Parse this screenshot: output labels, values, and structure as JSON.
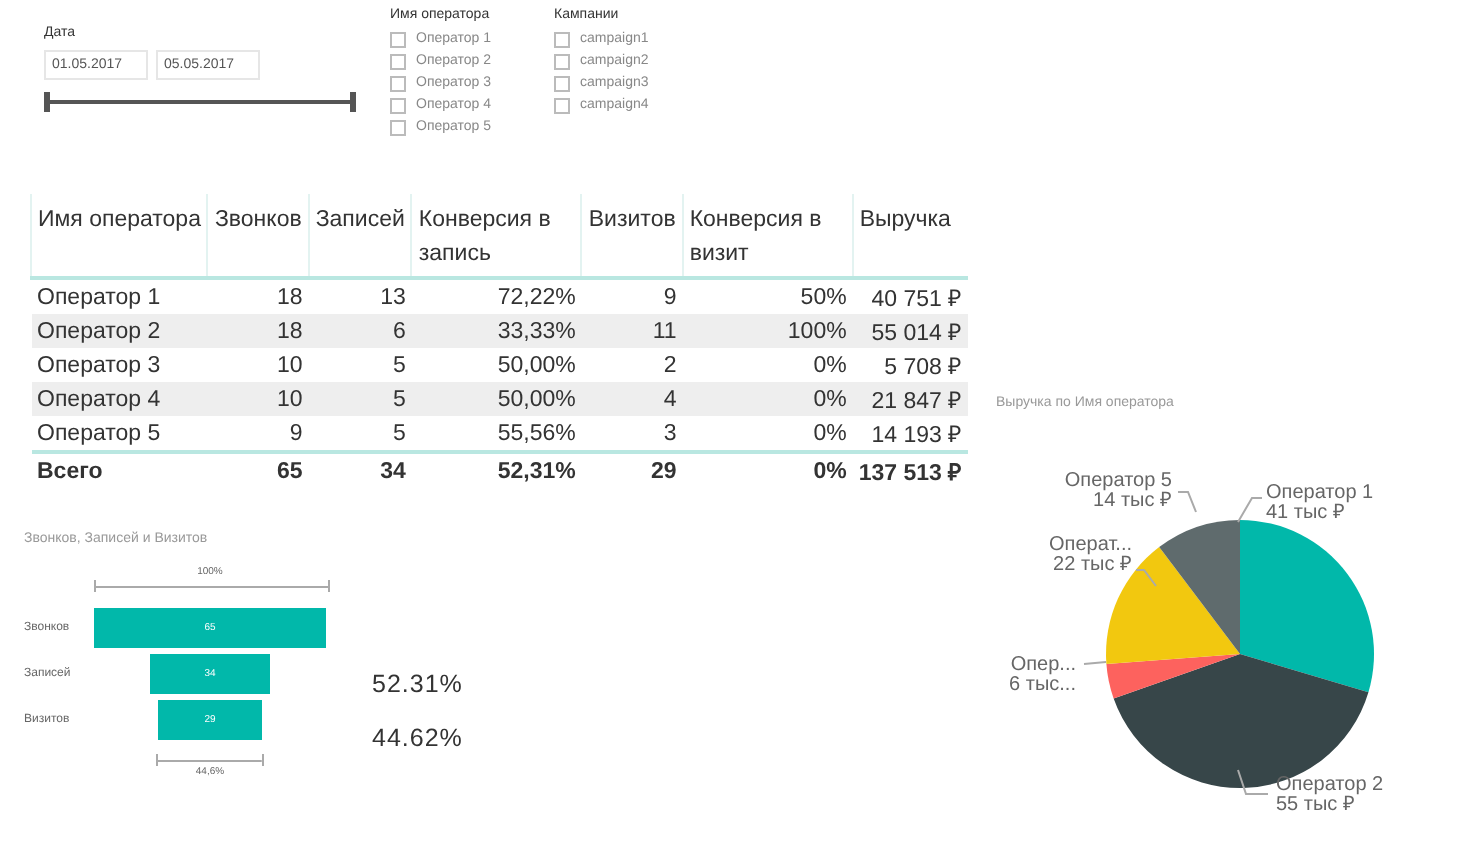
{
  "date_slicer": {
    "title": "Дата",
    "start": "01.05.2017",
    "end": "05.05.2017"
  },
  "operator_slicer": {
    "title": "Имя оператора",
    "items": [
      {
        "label": "Оператор 1",
        "checked": false
      },
      {
        "label": "Оператор 2",
        "checked": false
      },
      {
        "label": "Оператор 3",
        "checked": false
      },
      {
        "label": "Оператор 4",
        "checked": false
      },
      {
        "label": "Оператор 5",
        "checked": false
      }
    ]
  },
  "campaign_slicer": {
    "title": "Кампании",
    "items": [
      {
        "label": "campaign1",
        "checked": false
      },
      {
        "label": "campaign2",
        "checked": false
      },
      {
        "label": "campaign3",
        "checked": false
      },
      {
        "label": "campaign4",
        "checked": false
      }
    ]
  },
  "table": {
    "columns": [
      "Имя оператора",
      "Звонков",
      "Записей",
      "Конверсия в запись",
      "Визитов",
      "Конверсия в визит",
      "Выручка"
    ],
    "rows": [
      [
        "Оператор 1",
        "18",
        "13",
        "72,22%",
        "9",
        "50%",
        "40 751 ₽"
      ],
      [
        "Оператор 2",
        "18",
        "6",
        "33,33%",
        "11",
        "100%",
        "55 014 ₽"
      ],
      [
        "Оператор 3",
        "10",
        "5",
        "50,00%",
        "2",
        "0%",
        "5 708 ₽"
      ],
      [
        "Оператор 4",
        "10",
        "5",
        "50,00%",
        "4",
        "0%",
        "21 847 ₽"
      ],
      [
        "Оператор 5",
        "9",
        "5",
        "55,56%",
        "3",
        "0%",
        "14 193 ₽"
      ]
    ],
    "total": [
      "Всего",
      "65",
      "34",
      "52,31%",
      "29",
      "0%",
      "137 513 ₽"
    ]
  },
  "funnel": {
    "title": "Звонков, Записей и Визитов",
    "top_label": "100%",
    "bottom_label": "44,6%",
    "stages": [
      {
        "label": "Звонков",
        "value": "65"
      },
      {
        "label": "Записей",
        "value": "34"
      },
      {
        "label": "Визитов",
        "value": "29"
      }
    ]
  },
  "cards": [
    "52.31%",
    "44.62%"
  ],
  "pie": {
    "chart_data": {
      "type": "pie",
      "title": "Выручка по Имя оператора",
      "categories": [
        "Оператор 1",
        "Оператор 2",
        "Опер...",
        "Операт...",
        "Оператор 5"
      ],
      "series": [
        {
          "values": [
            29.6,
            40.0,
            4.2,
            15.9,
            10.3
          ]
        }
      ]
    },
    "slices": [
      {
        "value": "41 тыс ₽",
        "color": "#01b8aa"
      },
      {
        "value": "55 тыс ₽",
        "color": "#374649"
      },
      {
        "value": "6 тыс...",
        "color": "#fd625e"
      },
      {
        "value": "22 тыс ₽",
        "color": "#f2c80f"
      },
      {
        "value": "14 тыс ₽",
        "color": "#5f6b6d"
      }
    ]
  }
}
